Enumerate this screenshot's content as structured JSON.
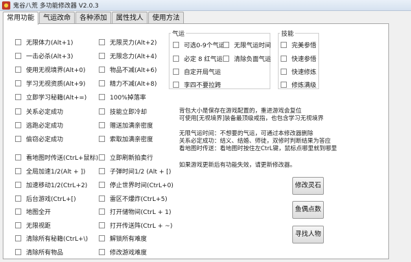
{
  "window": {
    "title": "鬼谷八荒 多功能修改器 V2.0.3"
  },
  "tabs": [
    "常用功能",
    "气运改命",
    "各种添加",
    "属性找人",
    "使用方法"
  ],
  "left_column": [
    "无限体力(Alt+1)",
    "一击必杀(Alt+3)",
    "使用无视境界(Alt+0)",
    "学习无视资质(Alt+9)",
    "立即学习秘籍(Alt+=)",
    "关系必定成功",
    "逃跑必定成功",
    "偷窃必定成功",
    "看地图时传送(CtrL+鼠标)",
    "全局加速1/2(Alt + ])",
    "加速移动1/2(CtrL+2)",
    "后台游戏(CtrL+[)",
    "地图全开",
    "无限视距",
    "清除所有秘籍(CtrL+\\)",
    "清除所有物品"
  ],
  "mid_column": [
    "无限灵力(Alt+2)",
    "无限念力(Alt+4)",
    "物品不减(Alt+6)",
    "精力不减(Alt+8)",
    "100%掉落率",
    "技能立即冷却",
    "赠送加满亲密度",
    "索取加满亲密度",
    "立即刷新拍卖行",
    "子弹时间1/2 (Alt + [)",
    "停止世界时间(CtrL+0)",
    "雷区不爆炸(CtrL+5)",
    "打开储物间(CtrL + 1)",
    "打开传送阵(CtrL + ~)",
    "解锁所有难度",
    "修改游戏难度"
  ],
  "qiyun_group": {
    "title": "气运",
    "items": [
      "可选0-9个气运",
      "无限气运时间",
      "必定 8 红气运",
      "清除负面气运",
      "自定开局气运",
      "李四不要拉跨"
    ]
  },
  "skill_group": {
    "title": "技能",
    "items": [
      "完美参悟",
      "快速参悟",
      "快速修炼",
      "修炼满级"
    ]
  },
  "info_lines": [
    "背包大小是保存在游戏配置的，重进游戏会复位",
    "可使用[无视境界]装备最顶级戒指，也包含学习无视境界",
    "无限气运时间：不想要的气运，可通过本修改器删除",
    "关系必定成功：结义、结婚、师徒，双修时判断结果为答应",
    "看地图时传送：看地图时按住左CtrL键，鼠标点哪里就到哪里",
    "如果游戏更新后有功能失效，请更新修改器。"
  ],
  "buttons": [
    "修改灵石",
    "鱼偶点数",
    "寻找人物"
  ]
}
